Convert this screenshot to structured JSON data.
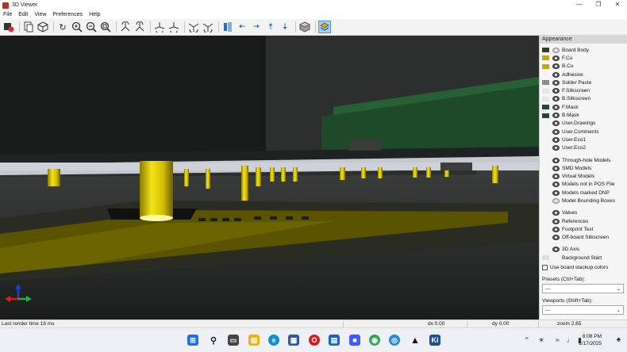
{
  "window": {
    "title": "3D Viewer"
  },
  "menu": [
    "File",
    "Edit",
    "View",
    "Preferences",
    "Help"
  ],
  "toolbar_icons": [
    "render-icon",
    "copy-icon",
    "cube-view-icon",
    "reload-icon",
    "zoom-in-icon",
    "zoom-out-icon",
    "zoom-fit-icon",
    "rotate-x-cw-icon",
    "rotate-x-ccw-icon",
    "rotate-y-cw-icon",
    "rotate-y-ccw-icon",
    "rotate-z-cw-icon",
    "rotate-z-ccw-icon",
    "flip-board-icon",
    "pan-left-icon",
    "pan-right-icon",
    "pan-up-icon",
    "pan-down-icon",
    "orthographic-icon",
    "show-layers-icon"
  ],
  "appearance": {
    "header": "Appearance",
    "layers": [
      {
        "label": "Board Body",
        "swatch": "#3b3a2a",
        "state": "bbox"
      },
      {
        "label": "F.Cu",
        "swatch": "#c8a800",
        "state": "on"
      },
      {
        "label": "B.Cu",
        "swatch": "#c8a800",
        "state": "on"
      },
      {
        "label": "Adhesive",
        "swatch": "",
        "state": "off"
      },
      {
        "label": "Solder Paste",
        "swatch": "#8c8c8c",
        "state": "on"
      },
      {
        "label": "F.Silkscreen",
        "swatch": "#e6e6e6",
        "state": "on"
      },
      {
        "label": "B.Silkscreen",
        "swatch": "#e6e6e6",
        "state": "on"
      },
      {
        "label": "F.Mask",
        "swatch": "#1e4d2b",
        "state": "on"
      },
      {
        "label": "B.Mask",
        "swatch": "#1e4d2b",
        "state": "on"
      },
      {
        "label": "User.Drawings",
        "swatch": "",
        "state": "off"
      },
      {
        "label": "User.Comments",
        "swatch": "",
        "state": "off"
      },
      {
        "label": "User.Eco1",
        "swatch": "",
        "state": "off"
      },
      {
        "label": "User.Eco2",
        "swatch": "",
        "state": "off"
      }
    ],
    "models": [
      {
        "label": "Through-hole Models",
        "state": "on"
      },
      {
        "label": "SMD Models",
        "state": "on"
      },
      {
        "label": "Virtual Models",
        "state": "on"
      },
      {
        "label": "Models not in POS File",
        "state": "on"
      },
      {
        "label": "Models marked DNP",
        "state": "on"
      },
      {
        "label": "Model Bounding Boxes",
        "state": "bbox"
      }
    ],
    "texts": [
      {
        "label": "Values",
        "state": "on"
      },
      {
        "label": "References",
        "state": "on"
      },
      {
        "label": "Footprint Text",
        "state": "on"
      },
      {
        "label": "Off-board Silkscreen",
        "state": "on"
      }
    ],
    "axis": [
      {
        "label": "3D Axis",
        "state": "on"
      },
      {
        "label": "Background Start",
        "state": "swatch",
        "swatch": "#dcdceb"
      }
    ],
    "use_stackup": "Use board stackup colors",
    "presets_label": "Presets (Ctrl+Tab):",
    "presets_value": "---",
    "viewports_label": "Viewports (Shift+Tab):",
    "viewports_value": "---"
  },
  "status": {
    "render_time": "Last render time 16 ms",
    "dx": "dx 0.00",
    "dy": "dy 0.00",
    "zoom": "zoom 2.65"
  },
  "taskbar": {
    "time": "8:08 PM",
    "date": "1/17/2025"
  },
  "colors": {
    "copper_gold": "#d8c200",
    "board_dark": "#1b1d1b",
    "mask_green": "#1f4a2a",
    "accent_blue": "#1e70c8"
  }
}
